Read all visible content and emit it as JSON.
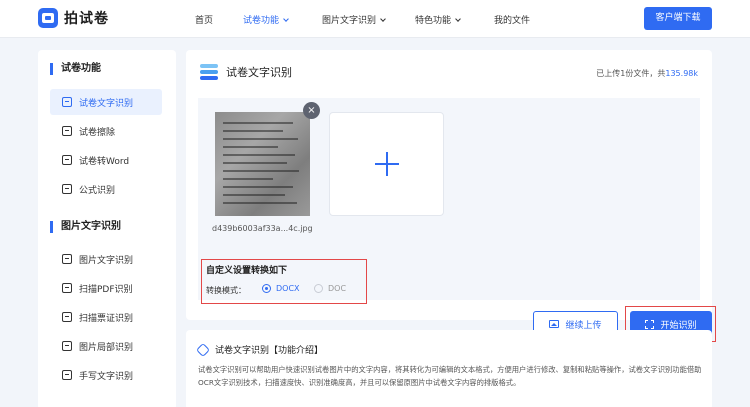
{
  "header": {
    "logo_text": "拍试卷",
    "nav": [
      {
        "label": "首页",
        "active": false,
        "dropdown": false
      },
      {
        "label": "试卷功能",
        "active": true,
        "dropdown": true
      },
      {
        "label": "图片文字识别",
        "active": false,
        "dropdown": true
      },
      {
        "label": "特色功能",
        "active": false,
        "dropdown": true
      },
      {
        "label": "我的文件",
        "active": false,
        "dropdown": false
      }
    ],
    "download_label": "客户端下载"
  },
  "sidebar": {
    "section1_title": "试卷功能",
    "section1_items": [
      {
        "label": "试卷文字识别",
        "active": true
      },
      {
        "label": "试卷擦除",
        "active": false
      },
      {
        "label": "试卷转Word",
        "active": false
      },
      {
        "label": "公式识别",
        "active": false
      }
    ],
    "section2_title": "图片文字识别",
    "section2_items": [
      {
        "label": "图片文字识别"
      },
      {
        "label": "扫描PDF识别"
      },
      {
        "label": "扫描票证识别"
      },
      {
        "label": "图片局部识别"
      },
      {
        "label": "手写文字识别"
      }
    ]
  },
  "main": {
    "title": "试卷文字识别",
    "upload_info_prefix": "已上传1份文件，共",
    "upload_info_size": "135.98k",
    "file_name": "d439b6003af33a...4c.jpg",
    "close_glyph": "×",
    "settings_title": "自定义设置转换如下",
    "mode_label": "转换模式：",
    "modes": [
      {
        "label": "DOCX",
        "selected": true
      },
      {
        "label": "DOC",
        "selected": false
      }
    ],
    "continue_label": "继续上传",
    "start_label": "开始识别"
  },
  "intro": {
    "title": "试卷文字识别【功能介绍】",
    "text": "试卷文字识别可以帮助用户快速识别试卷图片中的文字内容，将其转化为可编辑的文本格式，方便用户进行修改、复制和粘贴等操作，试卷文字识别功能借助OCR文字识别技术，扫描速度快、识别准确度高，并且可以保留原图片中试卷文字内容的排版格式。"
  },
  "colors": {
    "accent": "#2f6bf2",
    "highlight_border": "#e34848",
    "page_bg": "#f2f5fa"
  }
}
